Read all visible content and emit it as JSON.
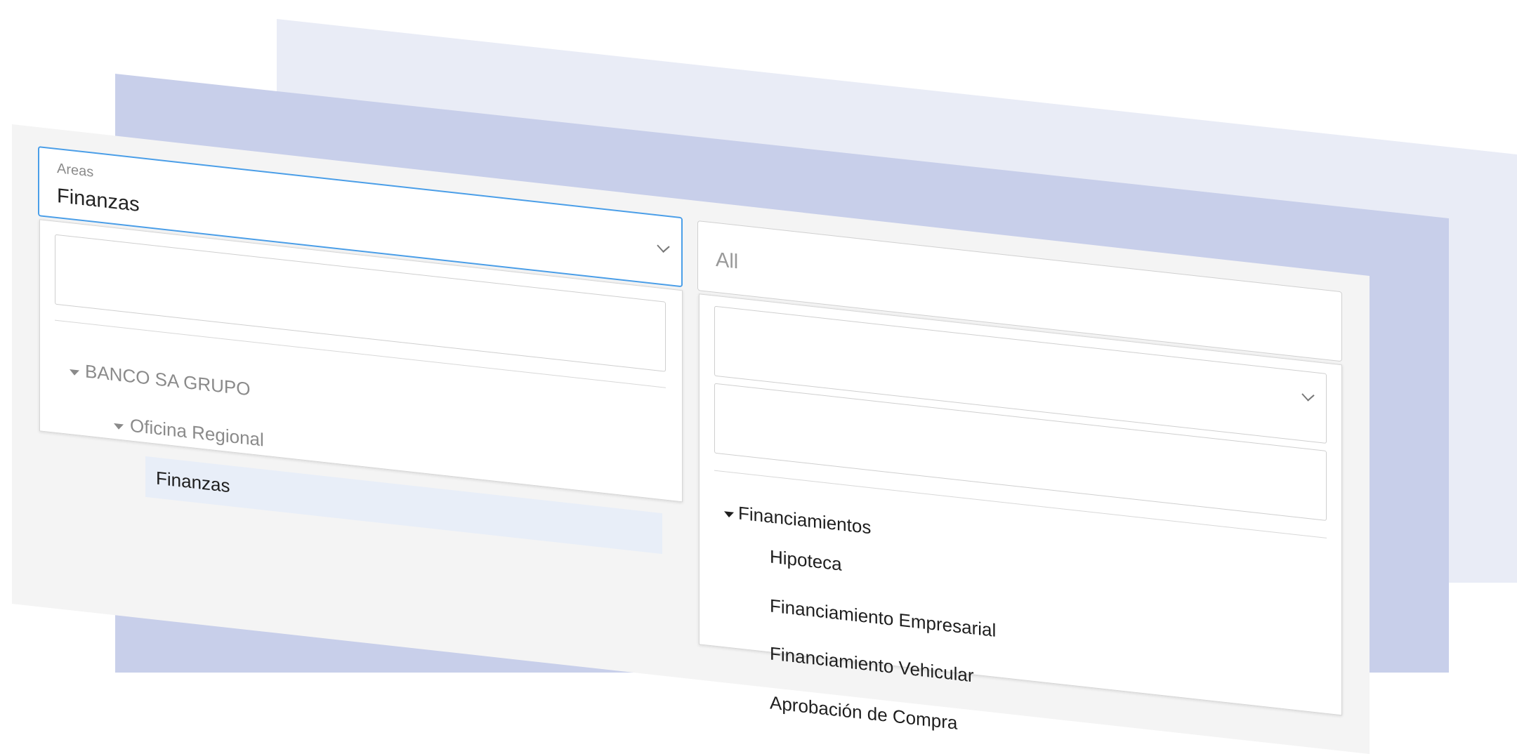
{
  "areas_field": {
    "label": "Areas",
    "value": "Finanzas"
  },
  "areas_tree": {
    "search_value": "",
    "root": {
      "label": "BANCO SA GRUPO",
      "children": [
        {
          "label": "Oficina Regional",
          "children": [
            {
              "label": "Finanzas",
              "selected": true
            }
          ]
        }
      ]
    }
  },
  "type_field": {
    "value": "All"
  },
  "type_tree": {
    "search_value": "",
    "group": "Financiamientos",
    "items": [
      "Hipoteca",
      "Financiamiento Empresarial",
      "Financiamiento Vehicular",
      "Aprobación de Compra"
    ]
  },
  "colors": {
    "accent": "#4a9ee8",
    "selected_row": "#e8eef8",
    "layer_back": "#e9ecf6",
    "layer_mid": "#c8cfea",
    "layer_front": "#f4f4f4"
  }
}
